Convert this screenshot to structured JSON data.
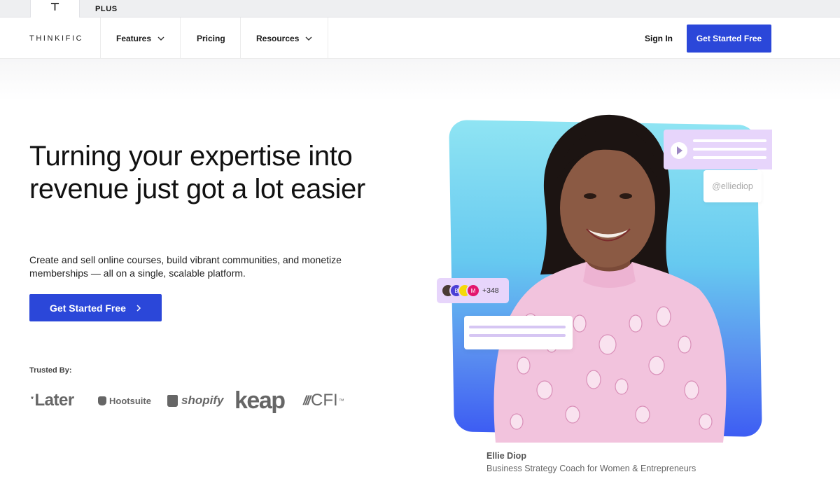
{
  "topbar": {
    "active_tab_mark": "⊤",
    "plus_tab_label": "PLUS"
  },
  "nav": {
    "logo_text": "THINKIFIC",
    "items": [
      {
        "label": "Features",
        "has_dropdown": true
      },
      {
        "label": "Pricing",
        "has_dropdown": false
      },
      {
        "label": "Resources",
        "has_dropdown": true
      }
    ],
    "sign_in_label": "Sign In",
    "cta_label": "Get Started Free",
    "cta_color": "#2b47d9"
  },
  "hero": {
    "headline": "Turning your expertise into revenue just got a lot easier",
    "subtext": "Create and sell online courses, build vibrant communities, and monetize memberships — all on a single, scalable platform.",
    "cta_label": "Get Started Free",
    "trusted_label": "Trusted By:",
    "trusted_logos": [
      {
        "name": "Later",
        "text": "ˑLater"
      },
      {
        "name": "Hootsuite",
        "text": "Hootsuite"
      },
      {
        "name": "Shopify",
        "text": "shopify"
      },
      {
        "name": "Keap",
        "text": "keap"
      },
      {
        "name": "CFI",
        "text": "CFI",
        "mark": "///",
        "tm": "™"
      }
    ]
  },
  "visual": {
    "handle": "@elliediop",
    "members": {
      "avatars": [
        {
          "initial": "",
          "color": "#4a3a34"
        },
        {
          "initial": "B",
          "color": "#4b3fd6"
        },
        {
          "initial": "",
          "color": "#f5d90a"
        },
        {
          "initial": "M",
          "color": "#e3156e"
        }
      ],
      "count": "+348"
    },
    "caption_name": "Ellie Diop",
    "caption_role": "Business Strategy Coach for Women & Entrepreneurs",
    "card_gradient": [
      "#8fe4f3",
      "#3d5df3"
    ],
    "accent_purple": "#e7d5fb"
  }
}
